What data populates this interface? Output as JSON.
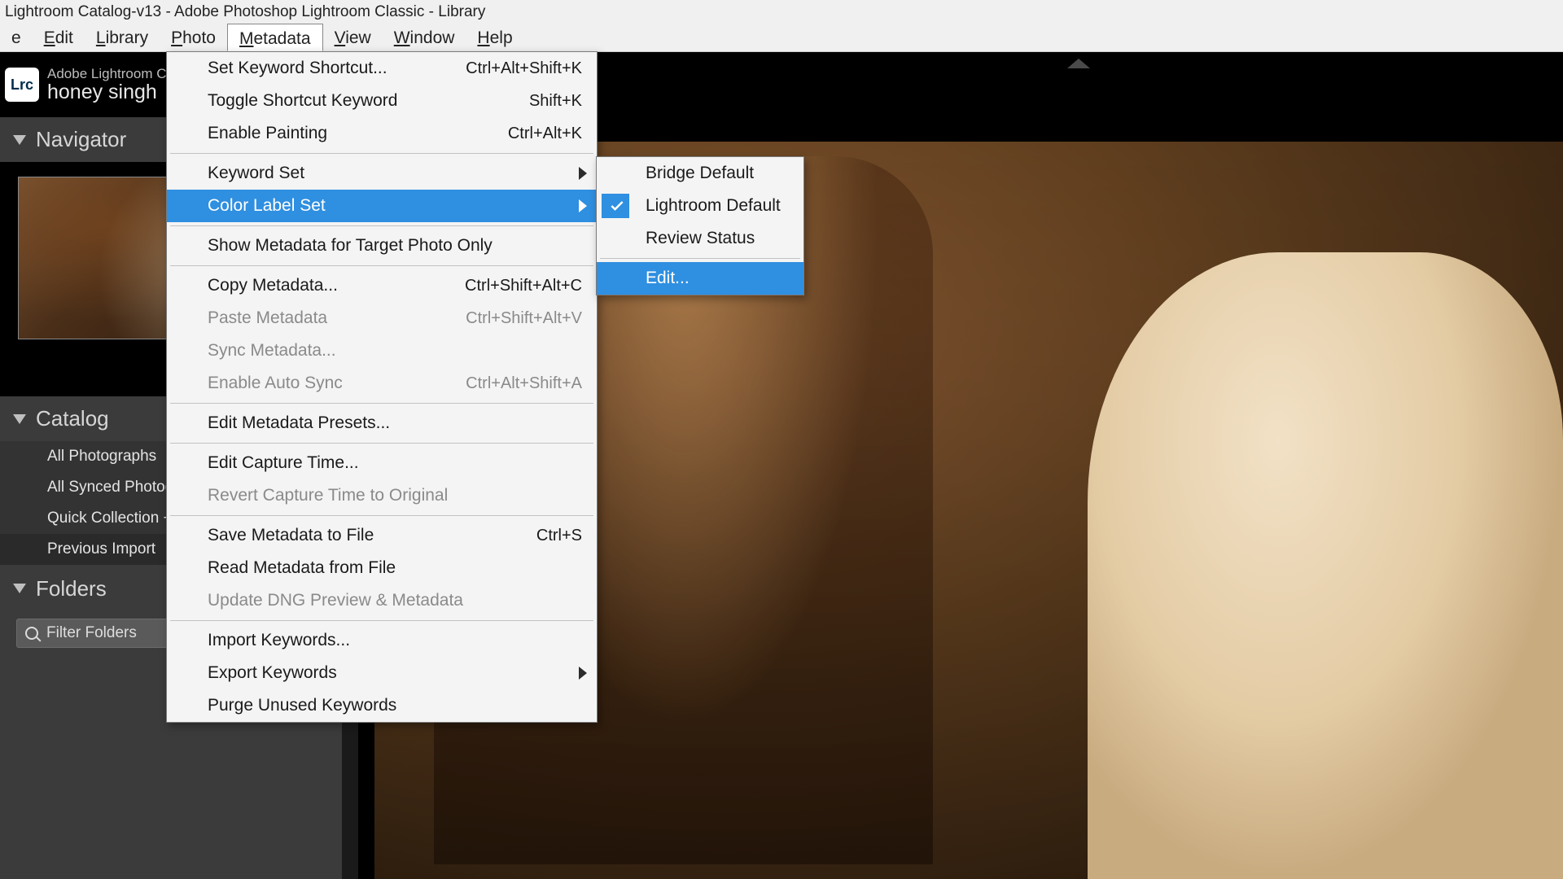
{
  "title": "Lightroom Catalog-v13 - Adobe Photoshop Lightroom Classic - Library",
  "menu": {
    "file_partial": "e",
    "edit": "Edit",
    "library": "Library",
    "photo": "Photo",
    "metadata": "Metadata",
    "view": "View",
    "window": "Window",
    "help": "Help"
  },
  "identity": {
    "logo": "Lrc",
    "line1": "Adobe Lightroom Clas",
    "line2": "honey singh"
  },
  "panels": {
    "navigator": "Navigator",
    "catalog_title": "Catalog",
    "catalog_items": [
      "All Photographs",
      "All Synced Photograp",
      "Quick Collection  +",
      "Previous Import"
    ],
    "folders": "Folders",
    "filter_placeholder": "Filter Folders"
  },
  "metadata_menu": [
    {
      "label": "Set Keyword Shortcut...",
      "shortcut": "Ctrl+Alt+Shift+K"
    },
    {
      "label": "Toggle Shortcut Keyword",
      "shortcut": "Shift+K"
    },
    {
      "label": "Enable Painting",
      "shortcut": "Ctrl+Alt+K"
    },
    {
      "sep": true
    },
    {
      "label": "Keyword Set",
      "sub": true
    },
    {
      "label": "Color Label Set",
      "sub": true,
      "hi": true
    },
    {
      "sep": true
    },
    {
      "label": "Show Metadata for Target Photo Only"
    },
    {
      "sep": true
    },
    {
      "label": "Copy Metadata...",
      "shortcut": "Ctrl+Shift+Alt+C"
    },
    {
      "label": "Paste Metadata",
      "shortcut": "Ctrl+Shift+Alt+V",
      "disabled": true
    },
    {
      "label": "Sync Metadata...",
      "disabled": true
    },
    {
      "label": "Enable Auto Sync",
      "shortcut": "Ctrl+Alt+Shift+A",
      "disabled": true
    },
    {
      "sep": true
    },
    {
      "label": "Edit Metadata Presets..."
    },
    {
      "sep": true
    },
    {
      "label": "Edit Capture Time..."
    },
    {
      "label": "Revert Capture Time to Original",
      "disabled": true
    },
    {
      "sep": true
    },
    {
      "label": "Save Metadata to File",
      "shortcut": "Ctrl+S"
    },
    {
      "label": "Read Metadata from File"
    },
    {
      "label": "Update DNG Preview & Metadata",
      "disabled": true
    },
    {
      "sep": true
    },
    {
      "label": "Import Keywords..."
    },
    {
      "label": "Export Keywords",
      "sub": true
    },
    {
      "label": "Purge Unused Keywords"
    }
  ],
  "color_label_submenu": [
    {
      "label": "Bridge Default"
    },
    {
      "label": "Lightroom Default",
      "checked": true
    },
    {
      "label": "Review Status"
    },
    {
      "sep": true
    },
    {
      "label": "Edit...",
      "hi": true
    }
  ]
}
